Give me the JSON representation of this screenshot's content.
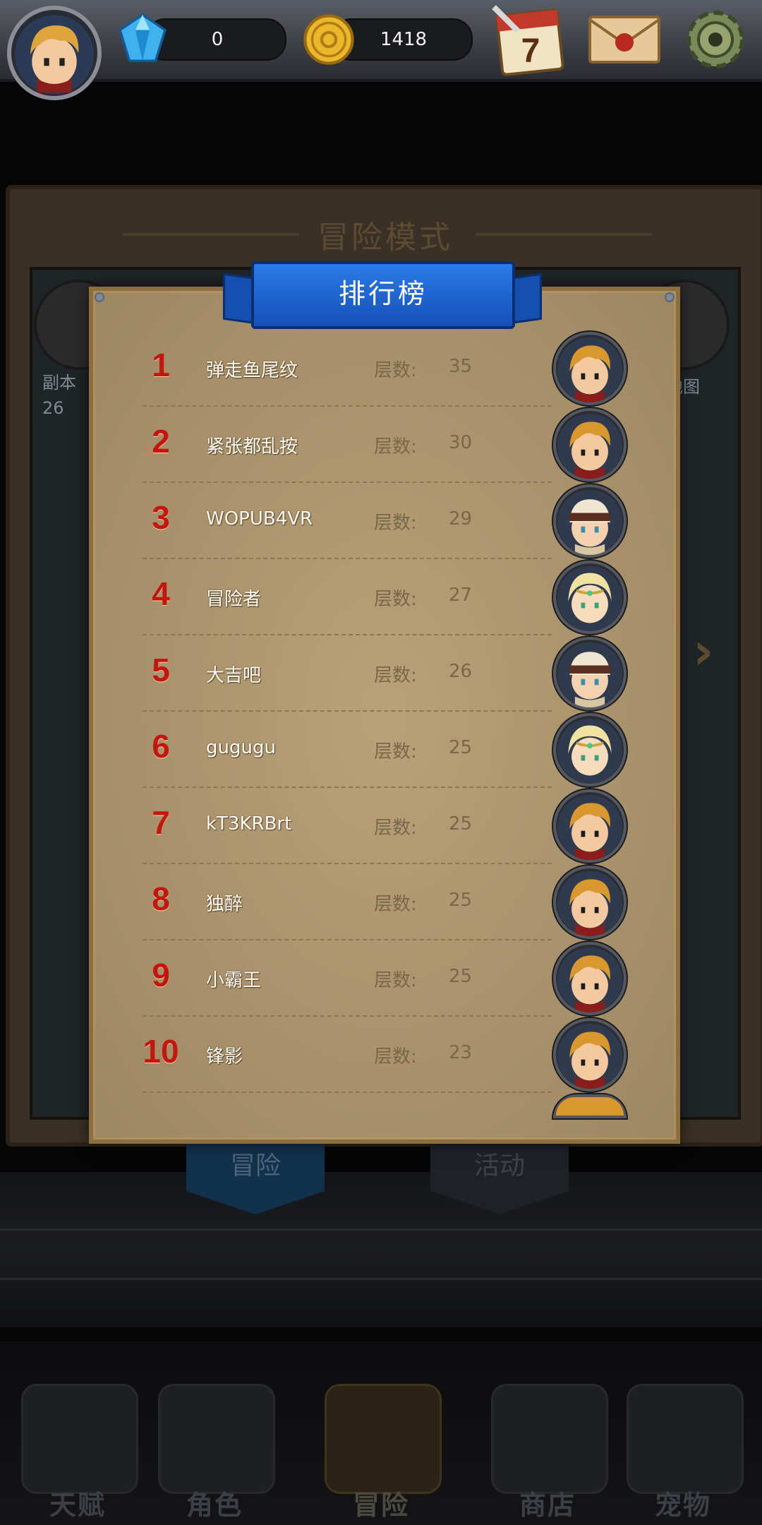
{
  "topbar": {
    "gems": "0",
    "coins": "1418",
    "calendar_day": "7"
  },
  "background": {
    "title": "冒险模式",
    "left_label_1": "副本",
    "left_label_2": "26",
    "right_label": "地图",
    "tab_adventure": "冒险",
    "tab_events": "活动"
  },
  "leaderboard": {
    "title": "排行榜",
    "floors_label": "层数:",
    "entries": [
      {
        "rank": "1",
        "name": "弹走鱼尾纹",
        "floors": "35",
        "avatar": "hero-blond"
      },
      {
        "rank": "2",
        "name": "紧张都乱按",
        "floors": "30",
        "avatar": "hero-blond"
      },
      {
        "rank": "3",
        "name": "WOPUB4VR",
        "floors": "29",
        "avatar": "hero-headband"
      },
      {
        "rank": "4",
        "name": "冒险者",
        "floors": "27",
        "avatar": "hero-elf"
      },
      {
        "rank": "5",
        "name": "大吉吧",
        "floors": "26",
        "avatar": "hero-headband"
      },
      {
        "rank": "6",
        "name": "gugugu",
        "floors": "25",
        "avatar": "hero-elf"
      },
      {
        "rank": "7",
        "name": "kT3KRBrt",
        "floors": "25",
        "avatar": "hero-blond"
      },
      {
        "rank": "8",
        "name": "独醉",
        "floors": "25",
        "avatar": "hero-blond"
      },
      {
        "rank": "9",
        "name": "小霸王",
        "floors": "25",
        "avatar": "hero-blond"
      },
      {
        "rank": "10",
        "name": "锋影",
        "floors": "23",
        "avatar": "hero-blond"
      }
    ]
  },
  "nav": {
    "items": [
      {
        "label": "天赋",
        "icon": "talent-book-icon"
      },
      {
        "label": "角色",
        "icon": "character-helmet-icon"
      },
      {
        "label": "冒险",
        "icon": "crossed-swords-icon"
      },
      {
        "label": "商店",
        "icon": "shop-house-icon"
      },
      {
        "label": "宠物",
        "icon": "pet-orc-icon"
      }
    ]
  }
}
